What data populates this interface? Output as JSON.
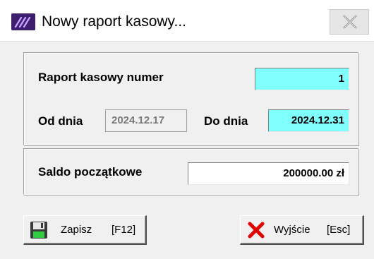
{
  "window": {
    "title": "Nowy raport kasowy...",
    "app_icon": "app-logo-icon",
    "close_icon": "close-icon"
  },
  "report": {
    "number_label": "Raport kasowy numer",
    "number_value": "1",
    "from_label": "Od dnia",
    "from_value": "2024.12.17",
    "to_label": "Do dnia",
    "to_value": "2024.12.31"
  },
  "balance": {
    "label": "Saldo początkowe",
    "value": "200000.00 zł"
  },
  "buttons": {
    "save_label": "Zapisz",
    "save_shortcut": "[F12]",
    "save_icon": "floppy-disk-icon",
    "exit_label": "Wyjście",
    "exit_shortcut": "[Esc]",
    "exit_icon": "red-x-icon"
  },
  "colors": {
    "editable_field": "#80ffff",
    "window_bg": "#f0f0f0",
    "app_icon_bg": "#3d1d6e"
  }
}
